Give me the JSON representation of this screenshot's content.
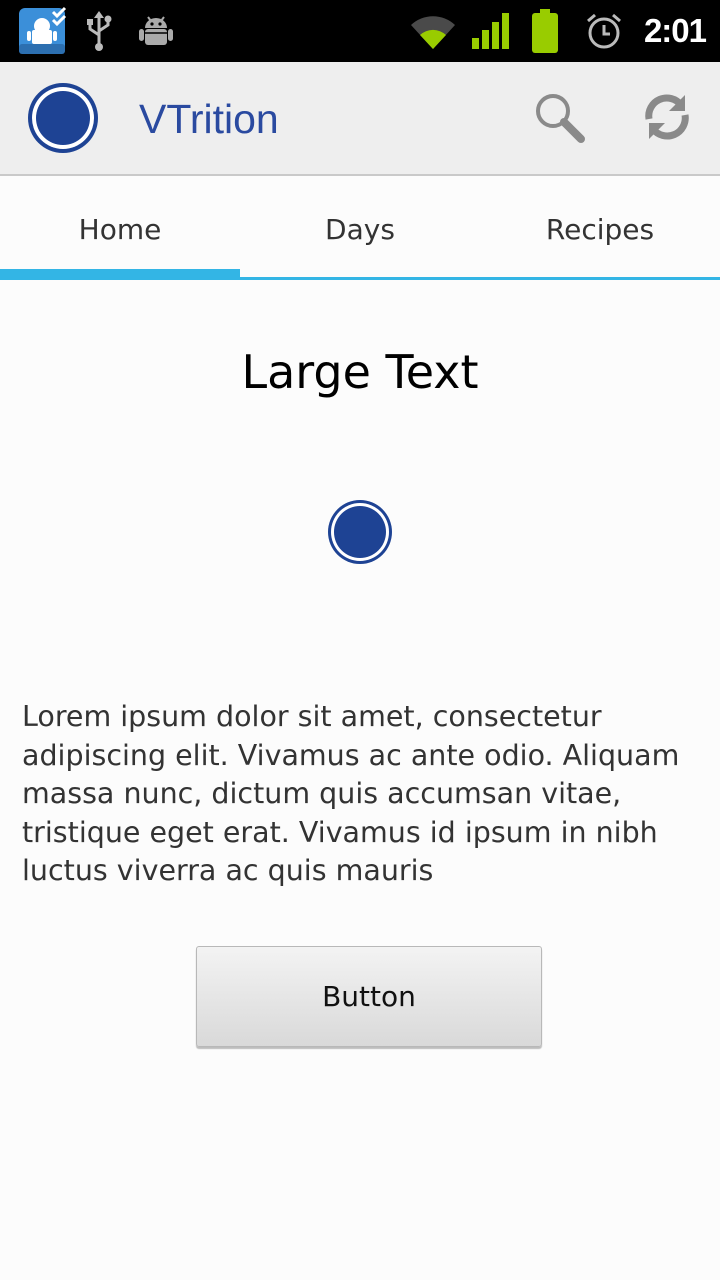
{
  "status_bar": {
    "time": "2:01",
    "icons": [
      "app-notification-icon",
      "usb-icon",
      "android-debug-icon",
      "wifi-icon",
      "signal-icon",
      "battery-icon",
      "alarm-icon"
    ],
    "accent_green": "#99cc00"
  },
  "action_bar": {
    "app_title": "VTrition",
    "actions": [
      "search-icon",
      "refresh-icon"
    ]
  },
  "tabs": [
    {
      "label": "Home",
      "selected": true
    },
    {
      "label": "Days",
      "selected": false
    },
    {
      "label": "Recipes",
      "selected": false
    }
  ],
  "content": {
    "heading": "Large Text",
    "body": "Lorem ipsum dolor sit amet, consectetur adipiscing elit. Vivamus ac ante odio. Aliquam massa nunc, dictum quis accumsan vitae, tristique eget erat. Vivamus id ipsum in nibh luctus viverra ac quis mauris",
    "button_label": "Button"
  },
  "colors": {
    "brand_blue": "#1e4394",
    "tab_accent": "#33b5e5",
    "title_blue": "#2a4aa0"
  }
}
